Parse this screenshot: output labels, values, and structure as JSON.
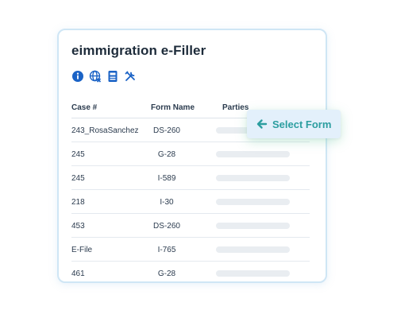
{
  "app": {
    "title": "eimmigration e-Filler"
  },
  "toolbar": {
    "icons": [
      "info-icon",
      "globe-icon",
      "document-icon",
      "tools-icon"
    ]
  },
  "table": {
    "columns": [
      "Case #",
      "Form Name",
      "Parties"
    ],
    "rows": [
      {
        "case": "243_RosaSanchez",
        "form": "DS-260"
      },
      {
        "case": "245",
        "form": "G-28"
      },
      {
        "case": "245",
        "form": "I-589"
      },
      {
        "case": "218",
        "form": "I-30"
      },
      {
        "case": "453",
        "form": "DS-260"
      },
      {
        "case": "E-File",
        "form": "I-765"
      },
      {
        "case": "461",
        "form": "G-28"
      }
    ]
  },
  "action": {
    "select_form_label": "Select Form"
  },
  "colors": {
    "icon_blue": "#1b63c6",
    "accent_teal": "#2c9ea0",
    "panel_border": "#cfe6f5"
  }
}
